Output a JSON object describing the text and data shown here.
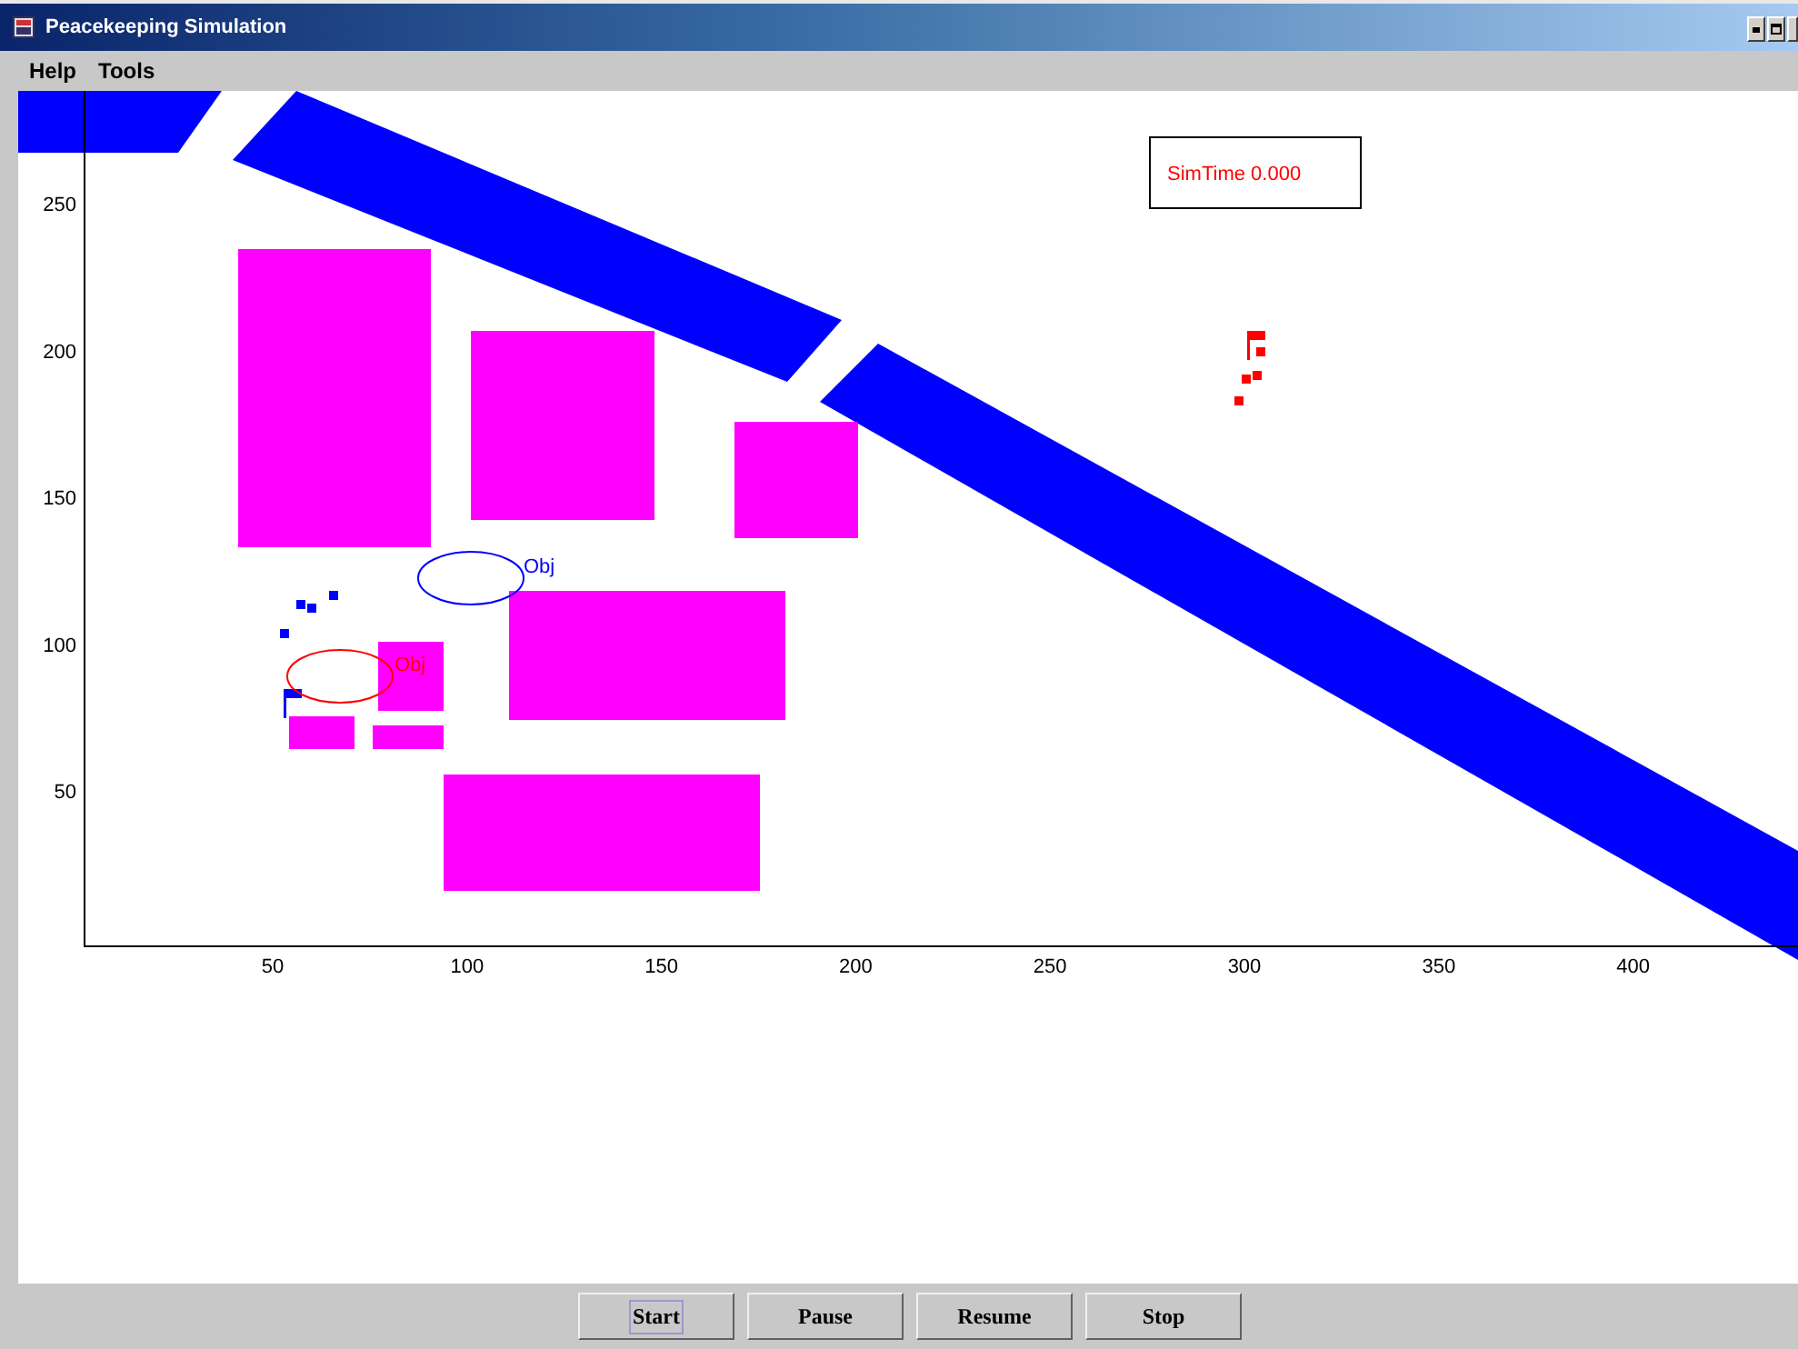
{
  "window": {
    "title": "Peacekeeping Simulation"
  },
  "menu": [
    "Help",
    "Tools"
  ],
  "plot": {
    "y_ticks": [
      "250",
      "200",
      "150",
      "100",
      "50"
    ],
    "x_ticks": [
      "50",
      "100",
      "150",
      "200",
      "250",
      "300",
      "350",
      "400"
    ],
    "sim_time": "SimTime 0.000",
    "objectives": [
      {
        "label": "Obj",
        "color": "#0000ff"
      },
      {
        "label": "Obj",
        "color": "#ff0000"
      }
    ]
  },
  "buttons": [
    {
      "label": "Start",
      "focused": true
    },
    {
      "label": "Pause",
      "focused": false
    },
    {
      "label": "Resume",
      "focused": false
    },
    {
      "label": "Stop",
      "focused": false
    }
  ]
}
